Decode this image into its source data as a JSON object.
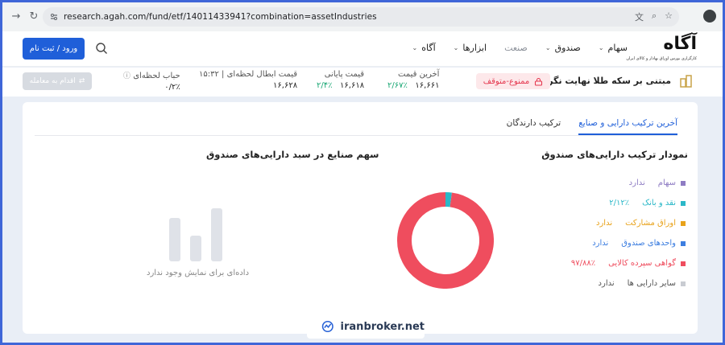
{
  "browser": {
    "url": "research.agah.com/fund/etf/14011433941?combination=assetIndustries",
    "icons": [
      "translate-icon",
      "zoom-icon",
      "star-icon"
    ]
  },
  "header": {
    "logo_text": "آگاه",
    "logo_subtitle": "کارگزاری بورس اوراق بهادار و کالای ایران",
    "nav": [
      {
        "label": "سهام",
        "has_menu": true,
        "muted": false
      },
      {
        "label": "صندوق",
        "has_menu": true,
        "muted": false
      },
      {
        "label": "صنعت",
        "has_menu": false,
        "muted": true
      },
      {
        "label": "ابزارها",
        "has_menu": true,
        "muted": false
      },
      {
        "label": "آگاه",
        "has_menu": true,
        "muted": false
      }
    ],
    "login_label": "ورود / ثبت نام"
  },
  "fund": {
    "name": "مبتنی بر سکه طلا نهایت نگر (ناب) |",
    "status": "ممنوع-متوقف",
    "last_price_label": "آخرین قیمت",
    "last_price": "۱۶,۶۶۱",
    "last_price_change": "۲/۶۷٪",
    "close_price_label": "قیمت پایانی",
    "close_price": "۱۶,۶۱۸",
    "close_price_change": "۲/۴٪",
    "nav_label": "قیمت ابطال لحظه‌ای | ۱۵:۳۲",
    "nav_value": "۱۶,۶۲۸",
    "bubble_label": "حباب لحظه‌ای",
    "bubble_value": "۰/۲٪",
    "trade_label": "اقدام به معامله"
  },
  "tabs": [
    {
      "label": "آخرین ترکیب دارایی و صنایع",
      "active": true
    },
    {
      "label": "ترکیب دارندگان",
      "active": false
    }
  ],
  "composition": {
    "title": "نمودار ترکیب دارایی‌های صندوق",
    "legend": [
      {
        "label": "سهام",
        "value": "ندارد",
        "color": "#8e7cc3",
        "value_color": "#8e7cc3"
      },
      {
        "label": "نقد و بانک",
        "value": "۲/۱۲٪",
        "color": "#2bb8c8",
        "value_color": "#2bb8c8"
      },
      {
        "label": "اوراق مشارکت",
        "value": "ندارد",
        "color": "#e8a21a",
        "value_color": "#e8a21a"
      },
      {
        "label": "واحدهای صندوق",
        "value": "ندارد",
        "color": "#3d7ee0",
        "value_color": "#3d7ee0"
      },
      {
        "label": "گواهی سپرده کالایی",
        "value": "۹۷/۸۸٪",
        "color": "#ef4d5e",
        "value_color": "#ef4d5e"
      },
      {
        "label": "سایر دارایی ها",
        "value": "ندارد",
        "color": "#c9ccd2",
        "value_color": "#555555"
      }
    ]
  },
  "chart_data": {
    "type": "pie",
    "donut": true,
    "slices": [
      {
        "name": "نقد و بانک",
        "value": 2.12,
        "color": "#2bb8c8"
      },
      {
        "name": "گواهی سپرده کالایی",
        "value": 97.88,
        "color": "#ef4d5e"
      }
    ]
  },
  "industries": {
    "title": "سهم صنایع در سبد دارایی‌های صندوق",
    "empty_message": "داده‌ای برای نمایش وجود ندارد"
  },
  "watermark": {
    "text": "iranbroker.net"
  }
}
